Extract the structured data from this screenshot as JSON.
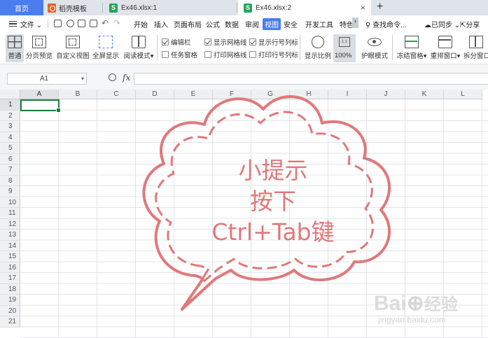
{
  "tabs": {
    "home": "首页",
    "template": "稻壳模板",
    "file1": "Ex46.xlsx:1",
    "file2": "Ex46.xlsx:2",
    "add": "+",
    "close": "×"
  },
  "menu": {
    "file": "文件",
    "items": [
      "开始",
      "插入",
      "页面布局",
      "公式",
      "数据",
      "审阅",
      "视图",
      "安全",
      "开发工具",
      "特色"
    ],
    "active_index": 6,
    "search": "查找命令...",
    "sync": "已同步",
    "share": "分享"
  },
  "ribbon": {
    "normal": "普通",
    "page_preview": "分页预览",
    "custom_view": "自定义视图",
    "full_screen": "全屏显示",
    "read_mode": "阅读模式",
    "cb_formula_bar": "编辑栏",
    "cb_task_pane": "任务窗格",
    "cb_show_gridlines": "显示网格线",
    "cb_print_gridlines": "打印网格线",
    "cb_show_headers": "显示行号列标",
    "cb_print_headers": "打印行号列标",
    "zoom": "显示比例",
    "zoom_100": "100%",
    "zoom_icon_text": "1:1",
    "eye_mode": "护眼模式",
    "freeze": "冻结窗格",
    "rearrange": "重排窗口",
    "split": "拆分窗口"
  },
  "checkboxes": {
    "formula_bar": true,
    "task_pane": false,
    "show_gridlines": true,
    "print_gridlines": false,
    "show_headers": true,
    "print_headers": false
  },
  "formula": {
    "cell_ref": "A1",
    "fx": "fx",
    "value": ""
  },
  "grid": {
    "columns": [
      "A",
      "B",
      "C",
      "D",
      "E",
      "F",
      "G",
      "H",
      "I",
      "J",
      "K",
      "L"
    ],
    "rows": [
      "1",
      "2",
      "3",
      "4",
      "5",
      "6",
      "7",
      "8",
      "9",
      "10",
      "11",
      "12",
      "13",
      "14",
      "15",
      "16",
      "17",
      "18",
      "19",
      "20",
      "21"
    ],
    "active_col": "A",
    "active_row": "1"
  },
  "overlay": {
    "line1": "小提示",
    "line2": "按下",
    "line3": "Ctrl+Tab键",
    "color": "#e1787b"
  },
  "watermark": {
    "brand": "Bai",
    "brand_cn": "经验",
    "url": "jingyan.baidu.com"
  }
}
